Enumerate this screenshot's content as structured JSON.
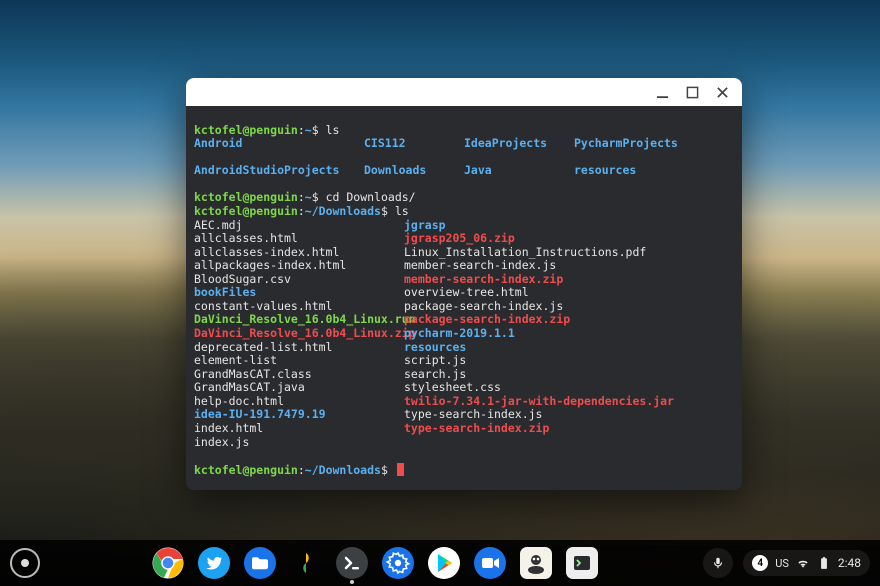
{
  "colors": {
    "term_bg": "#2a2b2f",
    "term_fg": "#e6e6e6",
    "ansi_green": "#7fd84b",
    "ansi_blue": "#5bb0ef",
    "ansi_red": "#ef4d4d",
    "titlebar_bg": "#ffffff",
    "cursor": "#ef4d4d"
  },
  "session": {
    "user": "kctofel",
    "host": "penguin",
    "home_path": "~",
    "downloads_path": "~/Downloads"
  },
  "prompts": {
    "p1_user": "kctofel@penguin",
    "p1_path": "~",
    "p1_sep": ":",
    "p1_sigil": "$",
    "p1_cmd": "ls",
    "p2_user": "kctofel@penguin",
    "p2_path": "~",
    "p2_cmd": "cd Downloads/",
    "p3_user": "kctofel@penguin",
    "p3_path": "~/Downloads",
    "p3_cmd": "ls",
    "p4_user": "kctofel@penguin",
    "p4_path": "~/Downloads",
    "p4_cmd": ""
  },
  "ls_home": {
    "r1c1": "Android",
    "r1c2": "CIS112",
    "r1c3": "IdeaProjects",
    "r1c4": "PycharmProjects",
    "r2c1": "AndroidStudioProjects",
    "r2c2": "Downloads",
    "r2c3": "Java",
    "r2c4": "resources"
  },
  "ls_downloads": {
    "left": [
      {
        "name": "AEC.mdj",
        "cls": "c-white"
      },
      {
        "name": "allclasses.html",
        "cls": "c-white"
      },
      {
        "name": "allclasses-index.html",
        "cls": "c-white"
      },
      {
        "name": "allpackages-index.html",
        "cls": "c-white"
      },
      {
        "name": "BloodSugar.csv",
        "cls": "c-white"
      },
      {
        "name": "bookFiles",
        "cls": "c-blue"
      },
      {
        "name": "constant-values.html",
        "cls": "c-white"
      },
      {
        "name": "DaVinci_Resolve_16.0b4_Linux.run",
        "cls": "c-green"
      },
      {
        "name": "DaVinci_Resolve_16.0b4_Linux.zip",
        "cls": "c-red"
      },
      {
        "name": "deprecated-list.html",
        "cls": "c-white"
      },
      {
        "name": "element-list",
        "cls": "c-white"
      },
      {
        "name": "GrandMasCAT.class",
        "cls": "c-white"
      },
      {
        "name": "GrandMasCAT.java",
        "cls": "c-white"
      },
      {
        "name": "help-doc.html",
        "cls": "c-white"
      },
      {
        "name": "idea-IU-191.7479.19",
        "cls": "c-blue"
      },
      {
        "name": "index.html",
        "cls": "c-white"
      },
      {
        "name": "index.js",
        "cls": "c-white"
      }
    ],
    "right": [
      {
        "name": "jgrasp",
        "cls": "c-blue"
      },
      {
        "name": "jgrasp205_06.zip",
        "cls": "c-red"
      },
      {
        "name": "Linux_Installation_Instructions.pdf",
        "cls": "c-white"
      },
      {
        "name": "member-search-index.js",
        "cls": "c-white"
      },
      {
        "name": "member-search-index.zip",
        "cls": "c-red"
      },
      {
        "name": "overview-tree.html",
        "cls": "c-white"
      },
      {
        "name": "package-search-index.js",
        "cls": "c-white"
      },
      {
        "name": "package-search-index.zip",
        "cls": "c-red"
      },
      {
        "name": "pycharm-2019.1.1",
        "cls": "c-blue"
      },
      {
        "name": "resources",
        "cls": "c-blue"
      },
      {
        "name": "script.js",
        "cls": "c-white"
      },
      {
        "name": "search.js",
        "cls": "c-white"
      },
      {
        "name": "stylesheet.css",
        "cls": "c-white"
      },
      {
        "name": "twilio-7.34.1-jar-with-dependencies.jar",
        "cls": "c-red"
      },
      {
        "name": "type-search-index.js",
        "cls": "c-white"
      },
      {
        "name": "type-search-index.zip",
        "cls": "c-red"
      }
    ]
  },
  "shelf": {
    "notify_count": "4",
    "lang": "US",
    "clock": "2:48",
    "apps": [
      {
        "id": "chrome",
        "name": "chrome-icon"
      },
      {
        "id": "twitter",
        "name": "twitter-icon"
      },
      {
        "id": "files",
        "name": "files-icon"
      },
      {
        "id": "photos",
        "name": "photos-icon"
      },
      {
        "id": "terminal",
        "name": "terminal-icon",
        "active": true
      },
      {
        "id": "settings",
        "name": "settings-icon"
      },
      {
        "id": "play",
        "name": "play-store-icon"
      },
      {
        "id": "duo",
        "name": "video-call-icon"
      },
      {
        "id": "linux1",
        "name": "linux-app-icon"
      },
      {
        "id": "linux2",
        "name": "linux-app-icon-2"
      }
    ]
  }
}
